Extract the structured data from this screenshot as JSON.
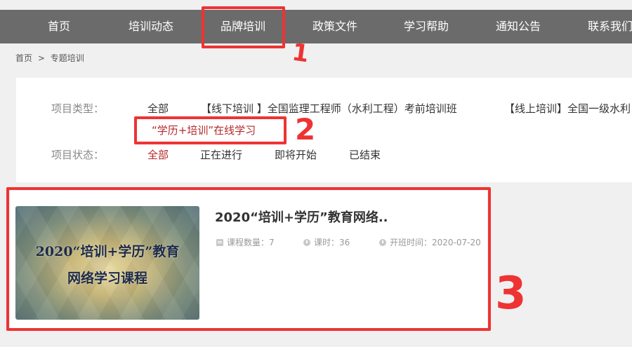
{
  "nav": {
    "items": [
      "首页",
      "培训动态",
      "品牌培训",
      "政策文件",
      "学习帮助",
      "通知公告",
      "联系我们"
    ]
  },
  "breadcrumb": {
    "home": "首页",
    "separator": ">",
    "current": "专题培训"
  },
  "filters": {
    "type_label": "项目类型：",
    "type_options": [
      "全部",
      "【线下培训 】全国监理工程师（水利工程）考前培训班",
      "【线上培训】全国一级水利",
      "“学历+培训”在线学习"
    ],
    "status_label": "项目状态：",
    "status_options": [
      "全部",
      "正在进行",
      "即将开始",
      "已结束"
    ],
    "active_status": "全部"
  },
  "course": {
    "title": "2020“培训+学历”教育网络..",
    "thumb_line1": "2020“培训+学历”教育",
    "thumb_line2": "网络学习课程",
    "course_count": "课程数量：7",
    "hours": "课时：36",
    "start_time": "开班时间：2020-07-20"
  },
  "annotations": {
    "a1": "1",
    "a2": "2",
    "a3": "3"
  },
  "colors": {
    "nav_bg": "#6b6b6b",
    "highlight": "#ee3333",
    "active_text": "#b5282b"
  }
}
